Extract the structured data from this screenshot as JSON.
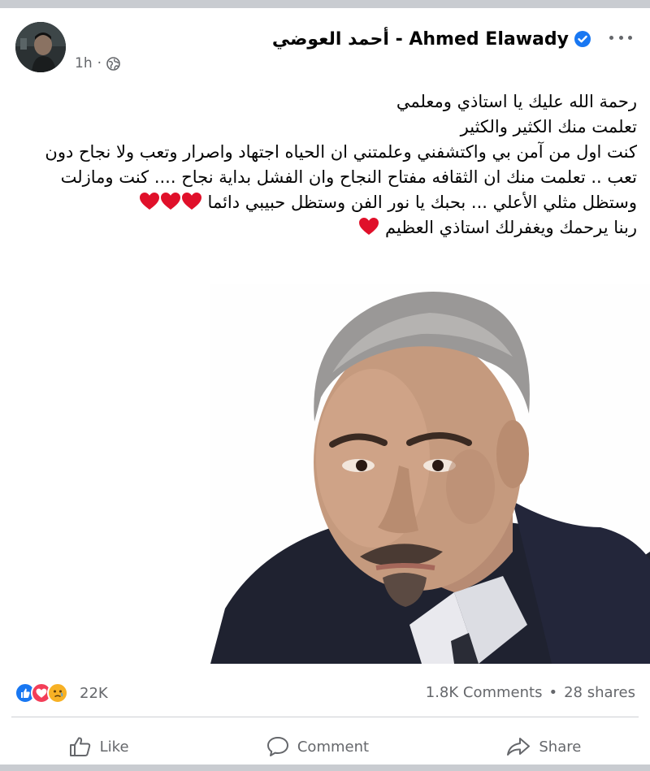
{
  "post": {
    "author_name": "أحمد العوضي - Ahmed Elawady",
    "verified": true,
    "time": "1h",
    "privacy": "public",
    "more_options_icon": "more-dots-icon",
    "text_lines": [
      "رحمة الله عليك يا استاذي ومعلمي",
      "تعلمت منك الكثير والكثير",
      "كنت اول من آمن بي واكتشفني وعلمتني ان الحياه اجتهاد واصرار وتعب ولا نجاح دون",
      "تعب .. تعلمت منك ان الثقافه مفتاح النجاح وان الفشل بداية نجاح .... كنت ومازلت",
      "وستظل مثلي الأعلي ... بحبك يا نور الفن  وستظل حبيبي دائما",
      "ربنا يرحمك ويغفرلك استاذي العظيم"
    ],
    "reactions": {
      "types": [
        "like",
        "love",
        "care"
      ],
      "count": "22K"
    },
    "stats": {
      "comments": "1.8K Comments",
      "separator": "•",
      "shares": "28 shares"
    },
    "actions": {
      "like": "Like",
      "comment": "Comment",
      "share": "Share"
    },
    "colors": {
      "like_blue": "#1877f2",
      "love_red": "#f33e58",
      "care_yellow": "#f7b125",
      "heart": "#e0102a",
      "secondary_text": "#65676b"
    }
  }
}
